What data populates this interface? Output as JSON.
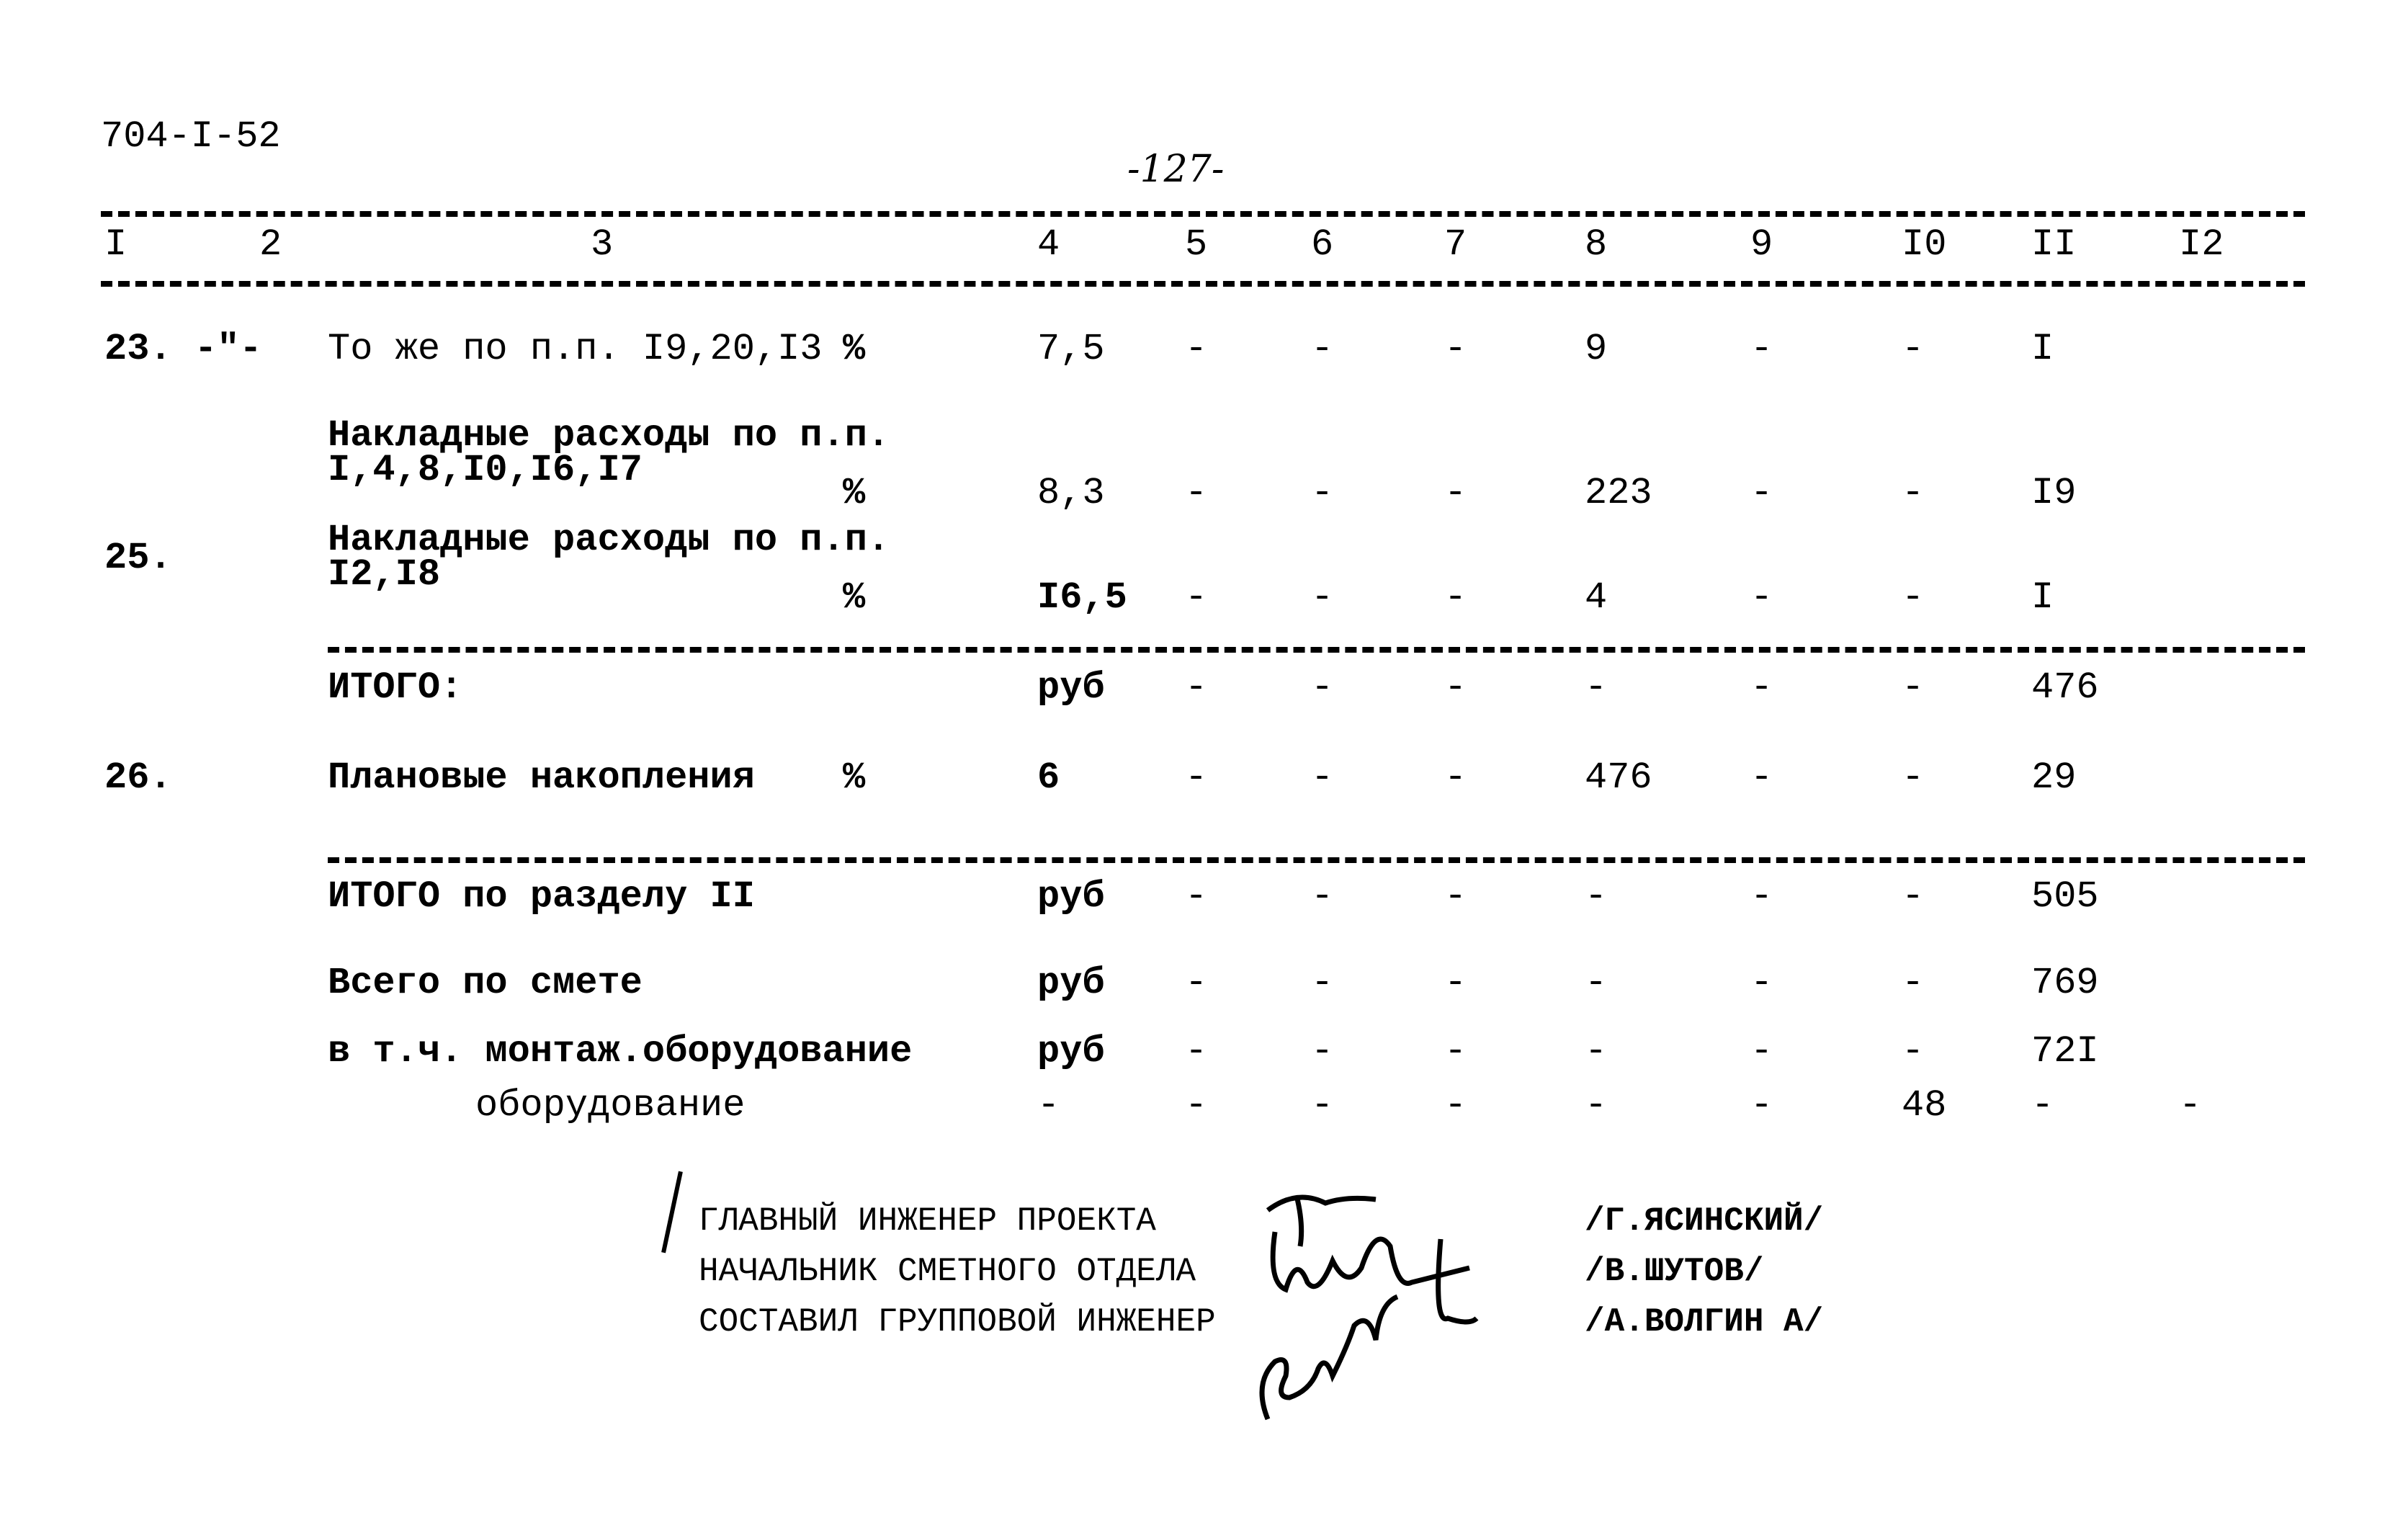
{
  "document": {
    "code": "704-I-52",
    "page_number": "-127-"
  },
  "table": {
    "column_headers": [
      "I",
      "2",
      "3",
      "4",
      "5",
      "6",
      "7",
      "8",
      "9",
      "I0",
      "II",
      "I2"
    ],
    "rows": [
      {
        "num": "23.",
        "ref": "-\"-",
        "description": [
          "То же по п.п. I9,20,I3"
        ],
        "unit": "%",
        "c4": "7,5",
        "c5": "-",
        "c6": "-",
        "c7": "-",
        "c8": "9",
        "c9": "-",
        "c10": "-",
        "c11": "I",
        "c12": ""
      },
      {
        "num": "",
        "ref": "",
        "description": [
          "Накладные расходы по п.п.",
          "I,4,8,I0,I6,I7"
        ],
        "unit": "%",
        "c4": "8,3",
        "c5": "-",
        "c6": "-",
        "c7": "-",
        "c8": "223",
        "c9": "-",
        "c10": "-",
        "c11": "I9",
        "c12": ""
      },
      {
        "num": "25.",
        "ref": "",
        "description": [
          "Накладные расходы по п.п.",
          "I2,I8"
        ],
        "unit": "%",
        "c4": "I6,5",
        "c5": "-",
        "c6": "-",
        "c7": "-",
        "c8": "4",
        "c9": "-",
        "c10": "-",
        "c11": "I",
        "c12": ""
      },
      {
        "num": "",
        "ref": "",
        "description": [
          "ИТОГО:"
        ],
        "unit": "",
        "c4": "руб",
        "c5": "-",
        "c6": "-",
        "c7": "-",
        "c8": "-",
        "c9": "-",
        "c10": "-",
        "c11": "476",
        "c12": ""
      },
      {
        "num": "26.",
        "ref": "",
        "description": [
          "Плановые накопления"
        ],
        "unit": "%",
        "c4": "6",
        "c5": "-",
        "c6": "-",
        "c7": "-",
        "c8": "476",
        "c9": "-",
        "c10": "-",
        "c11": "29",
        "c12": ""
      },
      {
        "num": "",
        "ref": "",
        "description": [
          "ИТОГО по разделу II"
        ],
        "unit": "",
        "c4": "руб",
        "c5": "-",
        "c6": "-",
        "c7": "-",
        "c8": "-",
        "c9": "-",
        "c10": "-",
        "c11": "505",
        "c12": ""
      },
      {
        "num": "",
        "ref": "",
        "description": [
          "Всего по смете"
        ],
        "unit": "",
        "c4": "руб",
        "c5": "-",
        "c6": "-",
        "c7": "-",
        "c8": "-",
        "c9": "-",
        "c10": "-",
        "c11": "769",
        "c12": ""
      },
      {
        "num": "",
        "ref": "",
        "description": [
          "в т.ч. монтаж.оборудование"
        ],
        "unit": "",
        "c4": "руб",
        "c5": "-",
        "c6": "-",
        "c7": "-",
        "c8": "-",
        "c9": "-",
        "c10": "-",
        "c11": "72I",
        "c12": ""
      },
      {
        "num": "",
        "ref": "",
        "description": [
          "оборудование"
        ],
        "unit": "",
        "c4": "-",
        "c5": "-",
        "c6": "-",
        "c7": "-",
        "c8": "-",
        "c9": "-",
        "c10": "48",
        "c11": "-",
        "c12": "-"
      }
    ]
  },
  "signatures": [
    {
      "title": "ГЛАВНЫЙ ИНЖЕНЕР ПРОЕКТА",
      "name": "/Г.ЯСИНСКИЙ/"
    },
    {
      "title": "НАЧАЛЬНИК СМЕТНОГО ОТДЕЛА",
      "name": "/В.ШУТОВ/"
    },
    {
      "title": "СОСТАВИЛ ГРУППОВОЙ ИНЖЕНЕР",
      "name": "/А.ВОЛГИН А/"
    }
  ]
}
